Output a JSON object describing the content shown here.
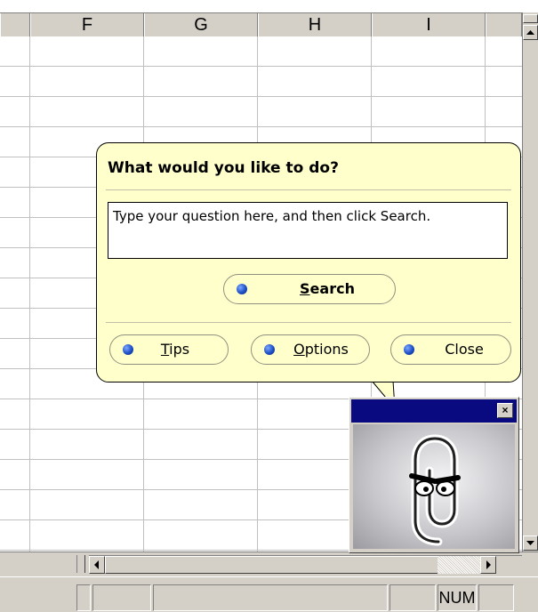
{
  "spreadsheet": {
    "columns": [
      "F",
      "G",
      "H",
      "I"
    ]
  },
  "balloon": {
    "title": "What would you like to do?",
    "question_text": "Type your question here, and then click Search.",
    "search_button": {
      "label": "Search",
      "accel": "S",
      "rest": "earch"
    },
    "tips_button": {
      "label": "Tips",
      "accel": "T",
      "rest": "ips"
    },
    "options_button": {
      "label": "Options",
      "accel": "O",
      "rest": "ptions"
    },
    "close_button": {
      "label": "Close"
    }
  },
  "assistant_window": {
    "close_glyph": "×",
    "character": "paperclip-office-assistant"
  },
  "status_bar": {
    "num_indicator": "NUM"
  },
  "icons": {
    "scroll_up": "triangle-up-icon",
    "scroll_down": "triangle-down-icon",
    "scroll_left": "triangle-left-icon",
    "scroll_right": "triangle-right-icon",
    "bullet": "blue-bullet-icon",
    "close": "close-icon"
  },
  "colors": {
    "balloon_bg": "#ffffcc",
    "titlebar": "#0a0a80",
    "chrome": "#d4d0c8",
    "gridline": "#c0c0c0",
    "bullet": "#1c4fc4"
  }
}
